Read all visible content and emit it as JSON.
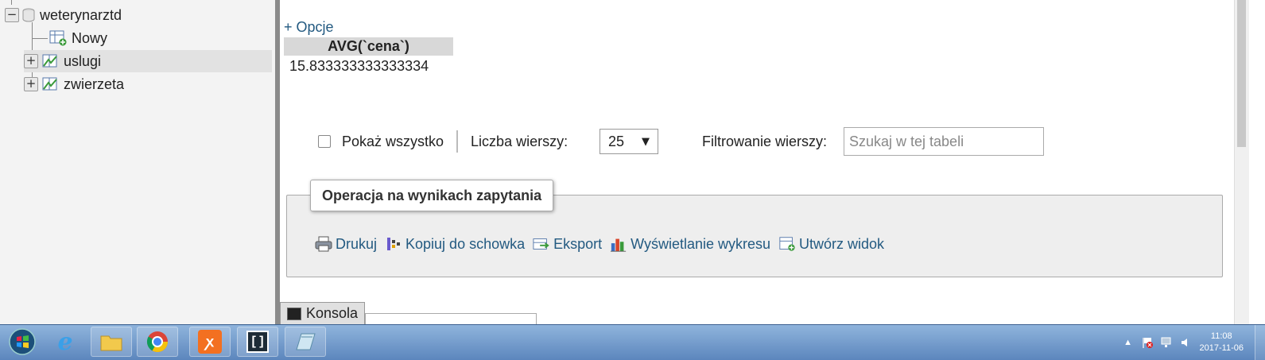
{
  "sidebar": {
    "database": "weterynarztd",
    "items": [
      {
        "label": "Nowy",
        "icon": "new-table-icon"
      },
      {
        "label": "uslugi",
        "icon": "table-icon",
        "active": true
      },
      {
        "label": "zwierzeta",
        "icon": "table-icon"
      }
    ]
  },
  "main": {
    "options_label": "+ Opcje",
    "result": {
      "column_header": "AVG(`cena`)",
      "value": "15.833333333333334"
    },
    "controls": {
      "show_all_label": "Pokaż wszystko",
      "rows_label": "Liczba wierszy:",
      "rows_value": "25",
      "filter_label": "Filtrowanie wierszy:",
      "filter_placeholder": "Szukaj w tej tabeli"
    },
    "operations": {
      "title": "Operacja na wynikach zapytania",
      "items": [
        {
          "label": "Drukuj",
          "icon": "print-icon"
        },
        {
          "label": "Kopiuj do schowka",
          "icon": "clipboard-icon"
        },
        {
          "label": "Eksport",
          "icon": "export-icon"
        },
        {
          "label": "Wyświetlanie wykresu",
          "icon": "chart-icon"
        },
        {
          "label": "Utwórz widok",
          "icon": "create-view-icon"
        }
      ]
    },
    "console_label": "Konsola"
  },
  "taskbar": {
    "time": "11:08",
    "date": "2017-11-06"
  },
  "colors": {
    "link": "#235a81",
    "sidebar_bg": "#f3f3f3",
    "taskbar": "#5c86bd"
  }
}
